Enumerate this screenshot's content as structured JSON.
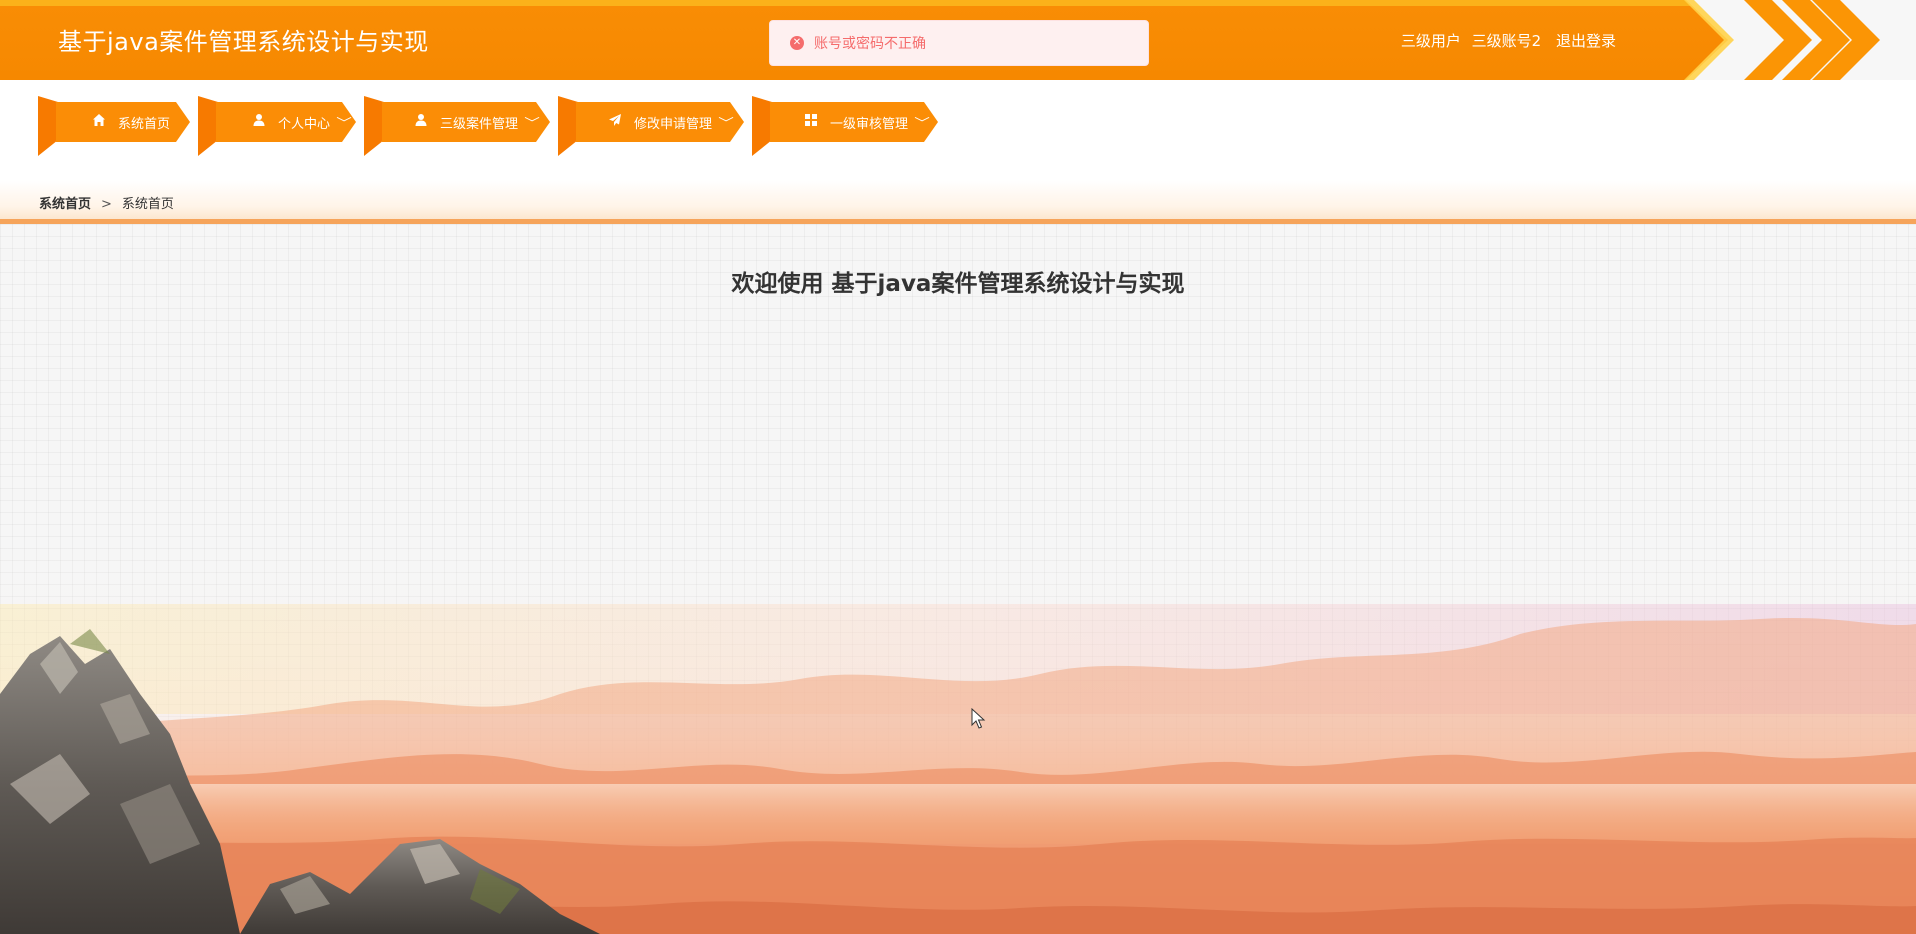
{
  "app": {
    "title": "基于java案件管理系统设计与实现"
  },
  "header": {
    "role": "三级用户",
    "username": "三级账号2",
    "logout_label": "退出登录"
  },
  "toast": {
    "message": "账号或密码不正确",
    "icon": "error-circle-icon",
    "color": "#f56c6c"
  },
  "nav": {
    "items": [
      {
        "label": "系统首页",
        "icon": "home-icon",
        "has_dropdown": false
      },
      {
        "label": "个人中心",
        "icon": "user-icon",
        "has_dropdown": true
      },
      {
        "label": "三级案件管理",
        "icon": "user-icon",
        "has_dropdown": true
      },
      {
        "label": "修改申请管理",
        "icon": "send-icon",
        "has_dropdown": true
      },
      {
        "label": "一级审核管理",
        "icon": "grid-icon",
        "has_dropdown": true
      }
    ]
  },
  "breadcrumb": {
    "root": "系统首页",
    "separator": ">",
    "current": "系统首页"
  },
  "main": {
    "welcome": "欢迎使用 基于java案件管理系统设计与实现"
  },
  "colors": {
    "header": "#f68800",
    "nav": "#fb8d06",
    "accent": "#f6a45a"
  }
}
